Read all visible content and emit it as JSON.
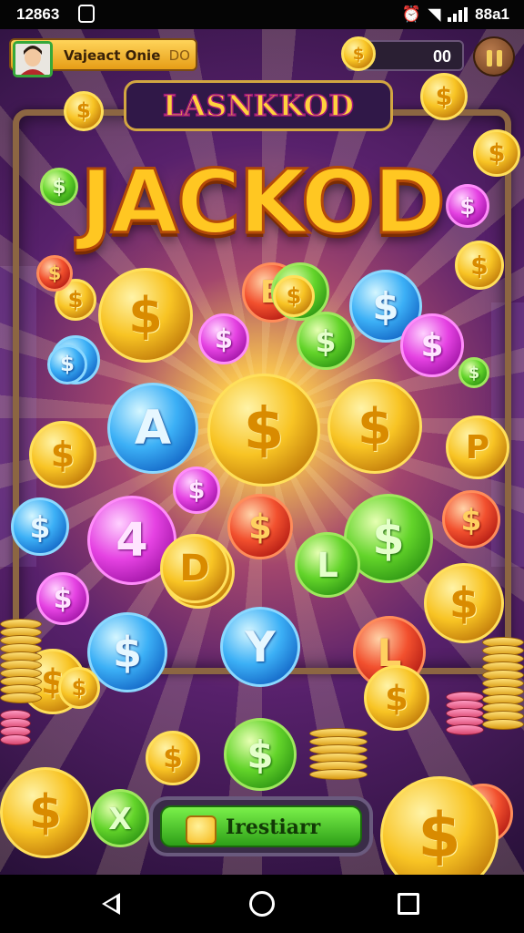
{
  "status_bar": {
    "time": "12863",
    "battery": "88a1"
  },
  "game": {
    "player_name": "Vajeact Onie",
    "player_suffix": "DO",
    "coin_count": "00",
    "title_small": "LASNKKOD",
    "title_big": "JACKOD",
    "collect_label": "Irestiarr"
  },
  "coins": [
    {
      "color": "gold",
      "symbol": "$"
    },
    {
      "color": "gold",
      "symbol": "$"
    },
    {
      "color": "gold",
      "symbol": "$"
    },
    {
      "color": "blue",
      "symbol": "A"
    },
    {
      "color": "gold",
      "symbol": "$"
    },
    {
      "color": "purple",
      "symbol": "4"
    },
    {
      "color": "gold",
      "symbol": "$"
    },
    {
      "color": "green",
      "symbol": "$"
    },
    {
      "color": "red",
      "symbol": "$"
    },
    {
      "color": "blue",
      "symbol": "$"
    },
    {
      "color": "purple",
      "symbol": "$"
    },
    {
      "color": "red",
      "symbol": "B"
    },
    {
      "color": "green",
      "symbol": "$"
    },
    {
      "color": "blue",
      "symbol": "$"
    },
    {
      "color": "purple",
      "symbol": "$"
    },
    {
      "color": "gold",
      "symbol": "$"
    },
    {
      "color": "purple",
      "symbol": "$"
    },
    {
      "color": "gold",
      "symbol": "P"
    },
    {
      "color": "red",
      "symbol": "$"
    },
    {
      "color": "gold",
      "symbol": "$"
    },
    {
      "color": "green",
      "symbol": "$"
    },
    {
      "color": "blue",
      "symbol": "$"
    },
    {
      "color": "purple",
      "symbol": "$"
    },
    {
      "color": "blue",
      "symbol": "$"
    },
    {
      "color": "gold",
      "symbol": "D"
    },
    {
      "color": "green",
      "symbol": "L"
    },
    {
      "color": "blue",
      "symbol": "Y"
    },
    {
      "color": "red",
      "symbol": "$"
    },
    {
      "color": "red",
      "symbol": "L"
    },
    {
      "color": "green",
      "symbol": "$"
    },
    {
      "color": "gold",
      "symbol": "$"
    },
    {
      "color": "gold",
      "symbol": "$"
    },
    {
      "color": "gold",
      "symbol": "$"
    },
    {
      "color": "gold",
      "symbol": "$"
    },
    {
      "color": "green",
      "symbol": "X"
    },
    {
      "color": "gold",
      "symbol": "$"
    },
    {
      "color": "red",
      "symbol": "$"
    },
    {
      "color": "gold",
      "symbol": "$"
    },
    {
      "color": "gold",
      "symbol": "$"
    },
    {
      "color": "gold",
      "symbol": "$"
    },
    {
      "color": "gold",
      "symbol": "$"
    },
    {
      "color": "green",
      "symbol": "$"
    },
    {
      "color": "blue",
      "symbol": "$"
    },
    {
      "color": "gold",
      "symbol": "$"
    },
    {
      "color": "gold",
      "symbol": "$"
    },
    {
      "color": "purple",
      "symbol": "$"
    },
    {
      "color": "red",
      "symbol": "$"
    },
    {
      "color": "green",
      "symbol": "$"
    }
  ]
}
